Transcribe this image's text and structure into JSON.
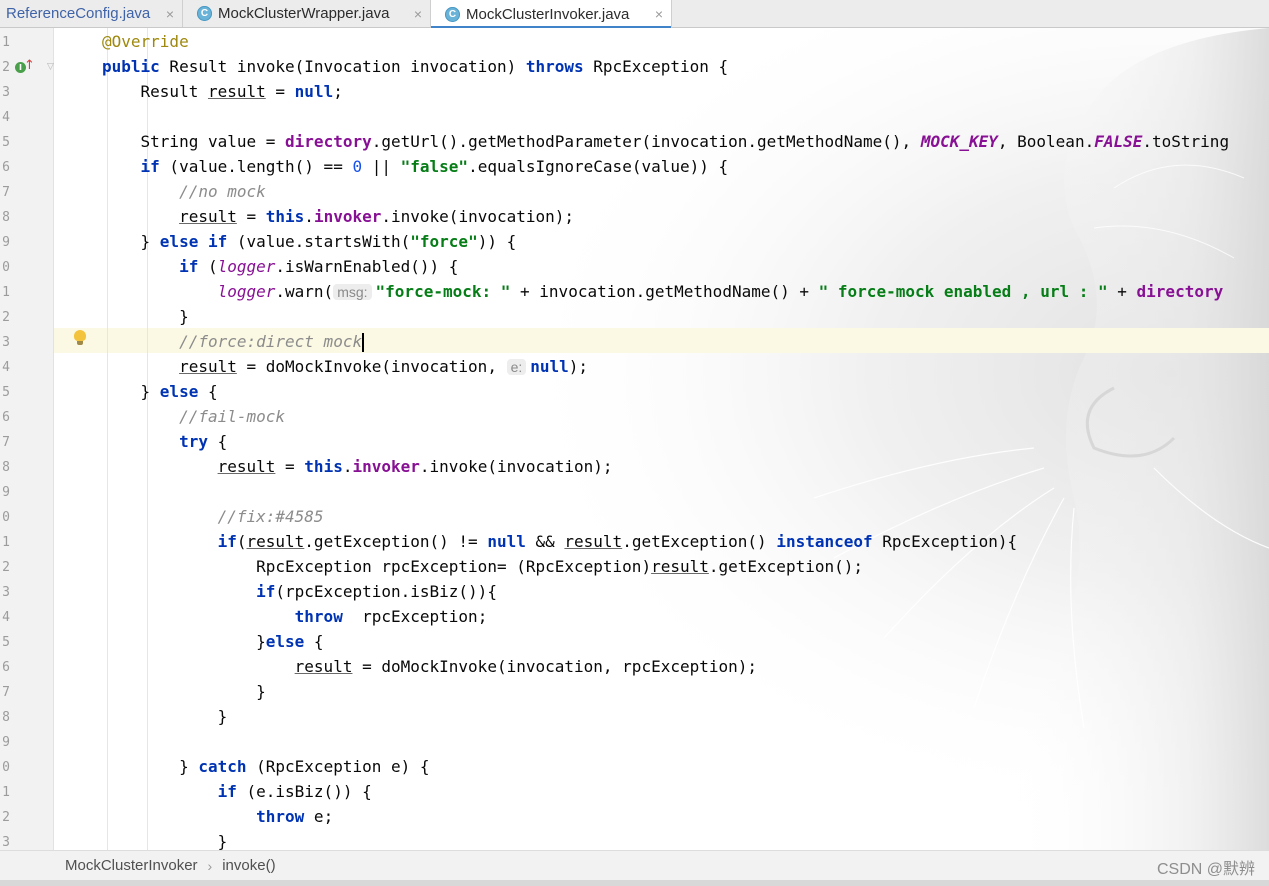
{
  "tabs": [
    {
      "label": "ReferenceConfig.java",
      "close": "×",
      "active": false
    },
    {
      "label": "MockClusterWrapper.java",
      "close": "×",
      "active": false,
      "icon": "class-icon"
    },
    {
      "label": "MockClusterInvoker.java",
      "close": "×",
      "active": true,
      "icon": "class-icon"
    }
  ],
  "class_icon_glyph": "C",
  "gutter": {
    "line_numbers": [
      "1",
      "2",
      "3",
      "4",
      "5",
      "6",
      "7",
      "8",
      "9",
      "0",
      "1",
      "2",
      "3",
      "4",
      "5",
      "6",
      "7",
      "8",
      "9",
      "0",
      "1",
      "2",
      "3",
      "4",
      "5",
      "6",
      "7",
      "8",
      "9",
      "0",
      "1",
      "2",
      "3"
    ],
    "impl_marker": "I",
    "arrow_marker": "↑",
    "fold_marker": "▽"
  },
  "editor": {
    "current_line_index": 12,
    "hints": {
      "msg": "msg:",
      "e": "e:"
    },
    "code": [
      "@Override",
      "public Result invoke(Invocation invocation) throws RpcException {",
      "    Result result = null;",
      "",
      "    String value = directory.getUrl().getMethodParameter(invocation.getMethodName(), MOCK_KEY, Boolean.FALSE.toString",
      "    if (value.length() == 0 || \"false\".equalsIgnoreCase(value)) {",
      "        //no mock",
      "        result = this.invoker.invoke(invocation);",
      "    } else if (value.startsWith(\"force\")) {",
      "        if (logger.isWarnEnabled()) {",
      "            logger.warn(\"force-mock: \" + invocation.getMethodName() + \" force-mock enabled , url : \" + directory",
      "        }",
      "        //force:direct mock",
      "        result = doMockInvoke(invocation, null);",
      "    } else {",
      "        //fail-mock",
      "        try {",
      "            result = this.invoker.invoke(invocation);",
      "",
      "            //fix:#4585",
      "            if(result.getException() != null && result.getException() instanceof RpcException){",
      "                RpcException rpcException= (RpcException)result.getException();",
      "                if(rpcException.isBiz()){",
      "                    throw  rpcException;",
      "                }else {",
      "                    result = doMockInvoke(invocation, rpcException);",
      "                }",
      "            }",
      "",
      "        } catch (RpcException e) {",
      "            if (e.isBiz()) {",
      "                throw e;",
      "            }"
    ]
  },
  "breadcrumb": {
    "items": [
      "MockClusterInvoker",
      "invoke()"
    ],
    "separator": "›"
  },
  "watermark": "CSDN @默辨",
  "colors": {
    "keyword": "#0033b3",
    "string": "#067d17",
    "comment": "#8c8c8c",
    "field": "#871094",
    "annotation": "#9e880d",
    "number": "#1750eb",
    "current_line": "#fbf8e3",
    "tab_underline": "#4083c9"
  }
}
